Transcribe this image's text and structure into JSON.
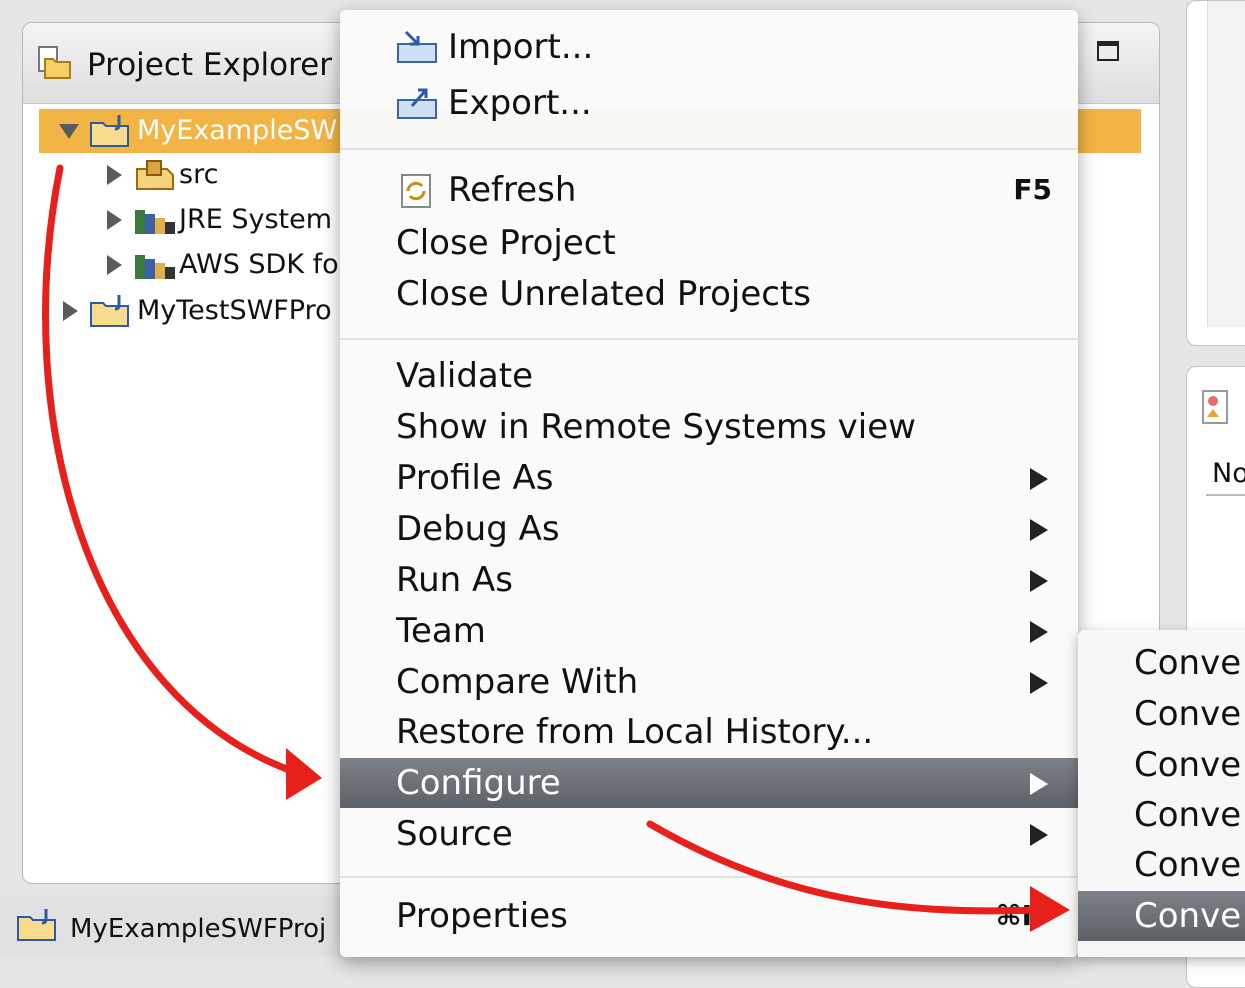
{
  "explorer": {
    "title": "Project Explorer",
    "tree": [
      {
        "label": "MyExampleSW",
        "state": "expanded",
        "selected": true
      },
      {
        "label": "src",
        "state": "collapsed",
        "selected": false
      },
      {
        "label": "JRE System",
        "state": "collapsed",
        "selected": false
      },
      {
        "label": "AWS SDK fo",
        "state": "collapsed",
        "selected": false
      },
      {
        "label": "MyTestSWFPro",
        "state": "collapsed",
        "selected": false
      }
    ]
  },
  "right_panel": {
    "label": "No"
  },
  "status_bar": {
    "text": "MyExampleSWFProj"
  },
  "context_menu": {
    "items": [
      {
        "label": "Import...",
        "shortcut": "",
        "has_submenu": false
      },
      {
        "label": "Export...",
        "shortcut": "",
        "has_submenu": false
      },
      {
        "label": "Refresh",
        "shortcut": "F5",
        "has_submenu": false
      },
      {
        "label": "Close Project",
        "shortcut": "",
        "has_submenu": false
      },
      {
        "label": "Close Unrelated Projects",
        "shortcut": "",
        "has_submenu": false
      },
      {
        "label": "Validate",
        "shortcut": "",
        "has_submenu": false
      },
      {
        "label": "Show in Remote Systems view",
        "shortcut": "",
        "has_submenu": false
      },
      {
        "label": "Profile As",
        "shortcut": "",
        "has_submenu": true
      },
      {
        "label": "Debug As",
        "shortcut": "",
        "has_submenu": true
      },
      {
        "label": "Run As",
        "shortcut": "",
        "has_submenu": true
      },
      {
        "label": "Team",
        "shortcut": "",
        "has_submenu": true
      },
      {
        "label": "Compare With",
        "shortcut": "",
        "has_submenu": true
      },
      {
        "label": "Restore from Local History...",
        "shortcut": "",
        "has_submenu": false
      },
      {
        "label": "Configure",
        "shortcut": "",
        "has_submenu": true,
        "highlighted": true
      },
      {
        "label": "Source",
        "shortcut": "",
        "has_submenu": true
      },
      {
        "label": "Properties",
        "shortcut": "⌘I",
        "has_submenu": false
      }
    ]
  },
  "submenu": {
    "items": [
      {
        "label": "Conve"
      },
      {
        "label": "Conve"
      },
      {
        "label": "Conve"
      },
      {
        "label": "Conve"
      },
      {
        "label": "Conve"
      },
      {
        "label": "Conve",
        "highlighted": true
      }
    ]
  },
  "colors": {
    "selection": "#f2b444",
    "menu_highlight": "#6a6f76",
    "annotation_arrow": "#e8201b"
  },
  "icons": {
    "explorer": "project-explorer-icon",
    "project": "java-project-folder-icon",
    "package": "source-package-icon",
    "library": "library-icon",
    "import": "import-icon",
    "export": "export-icon",
    "refresh": "refresh-icon",
    "maximize": "maximize-icon"
  }
}
